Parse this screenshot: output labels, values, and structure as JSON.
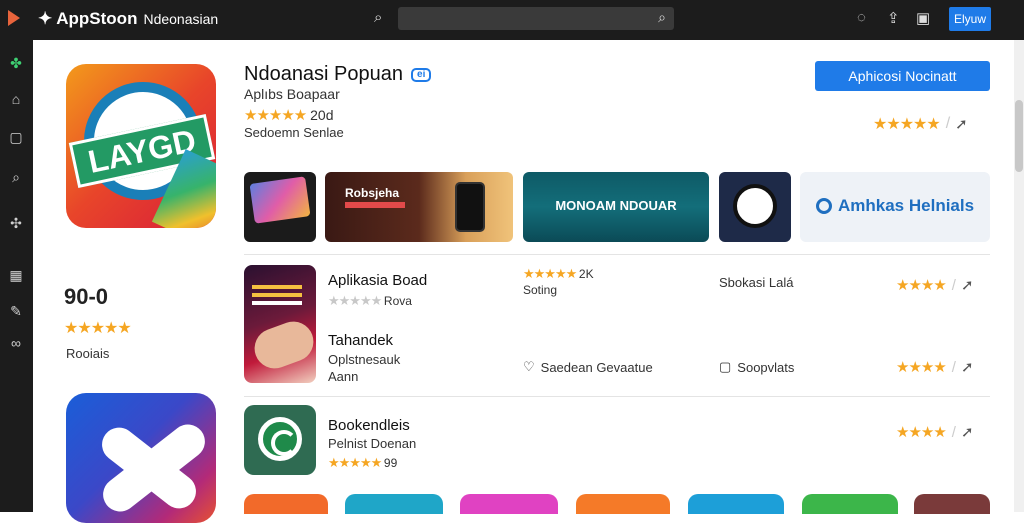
{
  "topbar": {
    "app_name": "AppStoon",
    "app_sub": "Ndeonasian",
    "search_placeholder": "",
    "button_label": "Elyuw"
  },
  "featured": {
    "title": "Ndoanasi Popuan",
    "badge": "ei",
    "subtitle": "Aplıbs Boapaar",
    "stars": "★★★★★",
    "rating_text": "20d",
    "category": "Sedoemn Senlae",
    "install_label": "Aphicosi Nocinatt",
    "right_stars": "★★★★★",
    "icon_label": "LAYGD"
  },
  "left_panel": {
    "rating_value": "90-0",
    "stars": "★★★★★",
    "reviews_label": "Rooiais"
  },
  "tiles": [
    {
      "label": ""
    },
    {
      "label": "Robsjeha"
    },
    {
      "label": "MONOAM NDOUAR"
    },
    {
      "label": ""
    },
    {
      "label": "Amhkas Helnials"
    }
  ],
  "list": [
    {
      "title": "Aplikasia Boad",
      "meta_stars": "★★★★★",
      "meta_text": "Rova",
      "col_stars": "★★★★★",
      "col_count": "2K",
      "col_label": "Soting",
      "col2": "Sbokasi Lalá",
      "rating": "★★★★"
    },
    {
      "title": "Tahandek",
      "sub": "Oplstnesauk",
      "sub2": "Aann",
      "col1": "Saedean Gevaatue",
      "col2": "Soopvlats",
      "rating": "★★★★"
    },
    {
      "title": "Bookendleis",
      "sub": "Pelnist Doenan",
      "stars": "★★★★★",
      "count": "99",
      "rating": "★★★★"
    }
  ],
  "colors": {
    "accent": "#1f7be8",
    "star": "#f5a623",
    "topbar": "#1c1c1c"
  },
  "icons": [
    "play-logo-icon",
    "appstore-logo-icon",
    "search-icon",
    "chat-icon",
    "share-icon",
    "download-icon",
    "gamepad-icon",
    "photo-icon",
    "book-icon",
    "search-side-icon",
    "puzzle-icon",
    "image-icon",
    "edit-icon",
    "settings-icon",
    "heart-icon",
    "calendar-icon",
    "arrow-icon"
  ]
}
